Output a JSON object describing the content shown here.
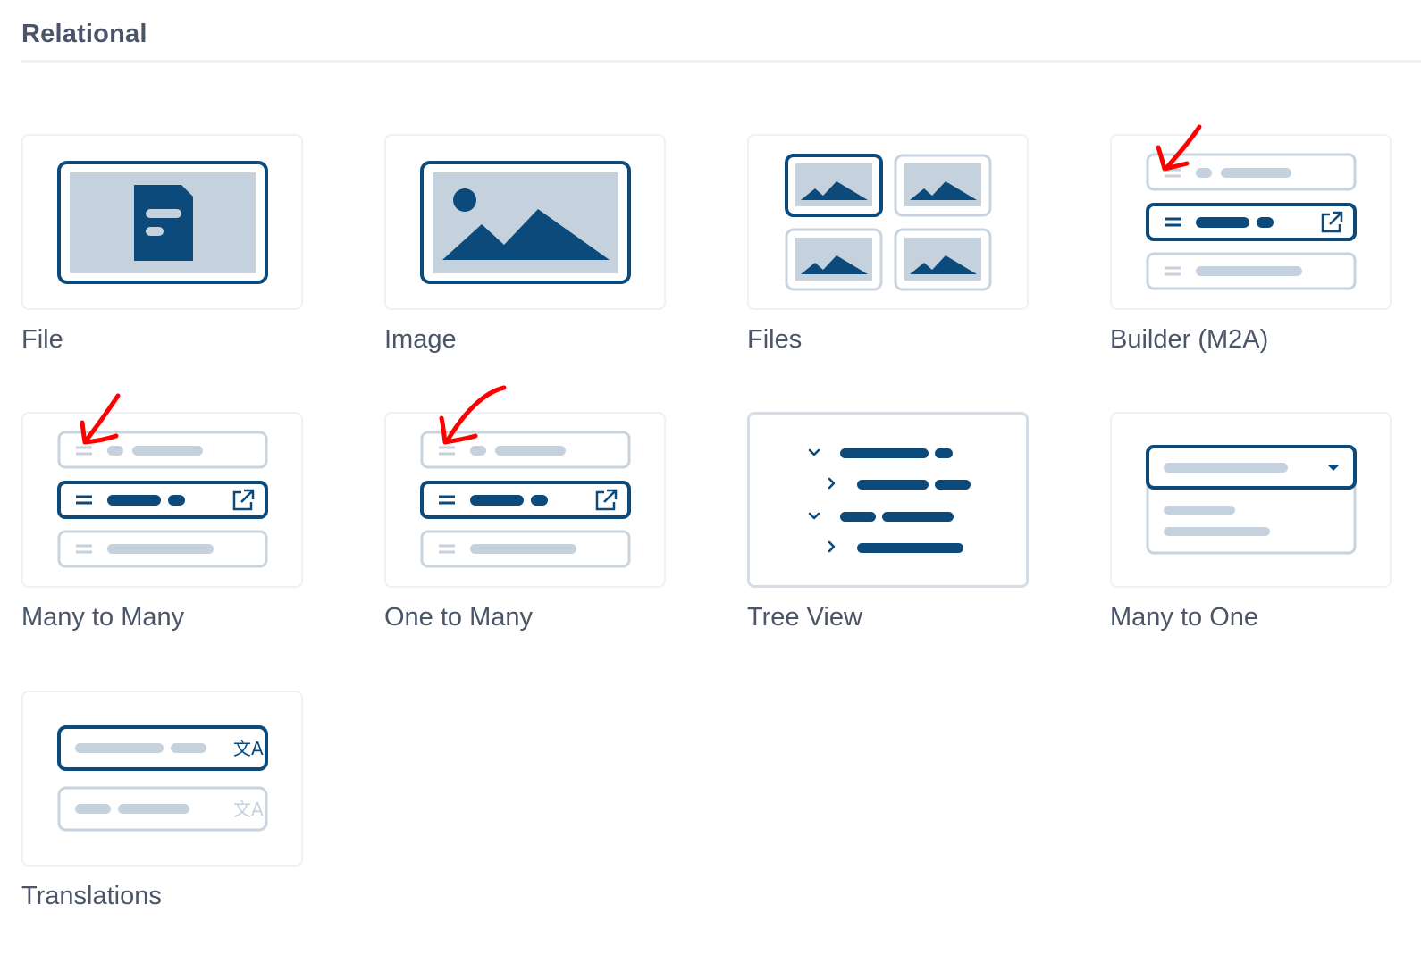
{
  "section": {
    "title": "Relational"
  },
  "interfaces": [
    {
      "label": "File",
      "icon": "file-icon"
    },
    {
      "label": "Image",
      "icon": "image-icon"
    },
    {
      "label": "Files",
      "icon": "files-icon"
    },
    {
      "label": "Builder (M2A)",
      "icon": "builder-m2a-icon"
    },
    {
      "label": "Many to Many",
      "icon": "many-to-many-icon"
    },
    {
      "label": "One to Many",
      "icon": "one-to-many-icon"
    },
    {
      "label": "Tree View",
      "icon": "tree-view-icon"
    },
    {
      "label": "Many to One",
      "icon": "many-to-one-icon"
    },
    {
      "label": "Translations",
      "icon": "translations-icon"
    }
  ],
  "colors": {
    "primary": "#0b4a7a",
    "muted": "#c5d2de",
    "muted_border": "#c8d3de",
    "card_border": "#eef1f5",
    "annotation": "#ff0000",
    "text": "#4a5568"
  }
}
